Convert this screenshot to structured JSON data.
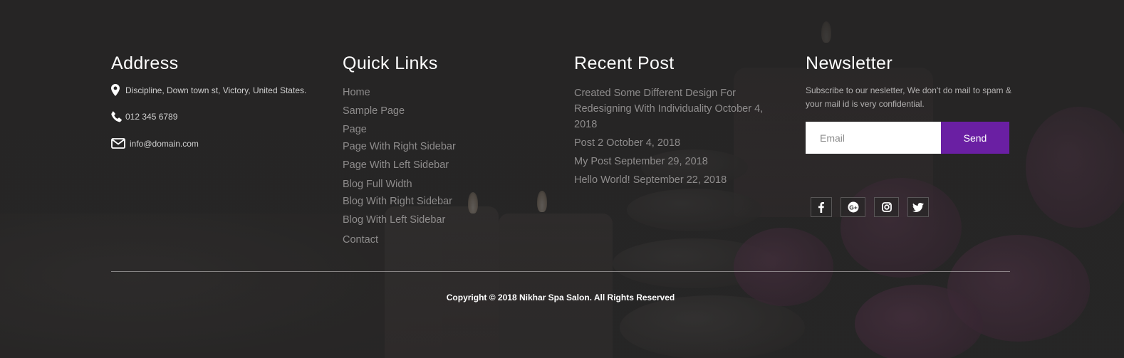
{
  "address": {
    "title": "Address",
    "location": "Discipline, Down town st, Victory, United States.",
    "phone": "012 345 6789",
    "email": "info@domain.com",
    "icons": [
      "map-marker-icon",
      "phone-icon",
      "envelope-icon"
    ]
  },
  "quick_links": {
    "title": "Quick Links",
    "items": [
      "Home",
      "Sample Page",
      "Page",
      "Page With Right Sidebar",
      "Page With Left Sidebar",
      "Blog Full Width",
      "Blog With Right Sidebar",
      "Blog With Left Sidebar",
      "Contact"
    ]
  },
  "recent_post": {
    "title": "Recent Post",
    "posts": [
      "Created Some Different Design For Redesigning With Individuality October 4, 2018",
      "Post 2 October 4, 2018",
      "My Post September 29, 2018",
      "Hello World! September 22, 2018"
    ]
  },
  "newsletter": {
    "title": "Newsletter",
    "description": "Subscribe to our nesletter, We don't do mail to spam & your mail id is very confidential.",
    "email_placeholder": "Email",
    "send_label": "Send",
    "send_color": "#6a1fa3"
  },
  "social": [
    "facebook-icon",
    "google-plus-icon",
    "instagram-icon",
    "twitter-icon"
  ],
  "copyright": "Copyright © 2018 Nikhar Spa Salon. All Rights Reserved",
  "colors": {
    "background": "#272626",
    "heading": "#ffffff",
    "link": "#8e8c8c"
  }
}
